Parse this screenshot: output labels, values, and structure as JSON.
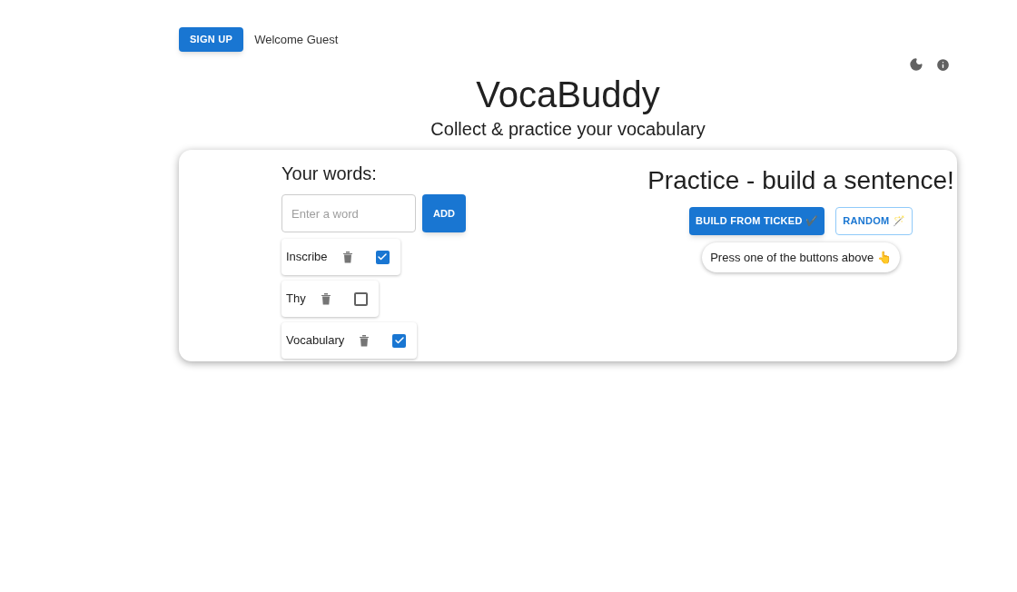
{
  "header": {
    "signup_button": "SIGN UP",
    "welcome": "Welcome Guest"
  },
  "title": "VocaBuddy",
  "subtitle": "Collect & practice your vocabulary",
  "words_panel": {
    "heading": "Your words:",
    "input": {
      "placeholder": "Enter a word"
    },
    "add_button": "ADD",
    "words": [
      {
        "text": "Inscribe",
        "checked": true
      },
      {
        "text": "Thy",
        "checked": false
      },
      {
        "text": "Vocabulary",
        "checked": true
      }
    ]
  },
  "practice_panel": {
    "heading": "Practice - build a sentence!",
    "buttons": [
      {
        "label": "BUILD FROM TICKED ✔️",
        "kind": "filled"
      },
      {
        "label": "RANDOM 🪄",
        "kind": "outlined"
      }
    ],
    "hint": "Press one of the buttons above 👆"
  }
}
